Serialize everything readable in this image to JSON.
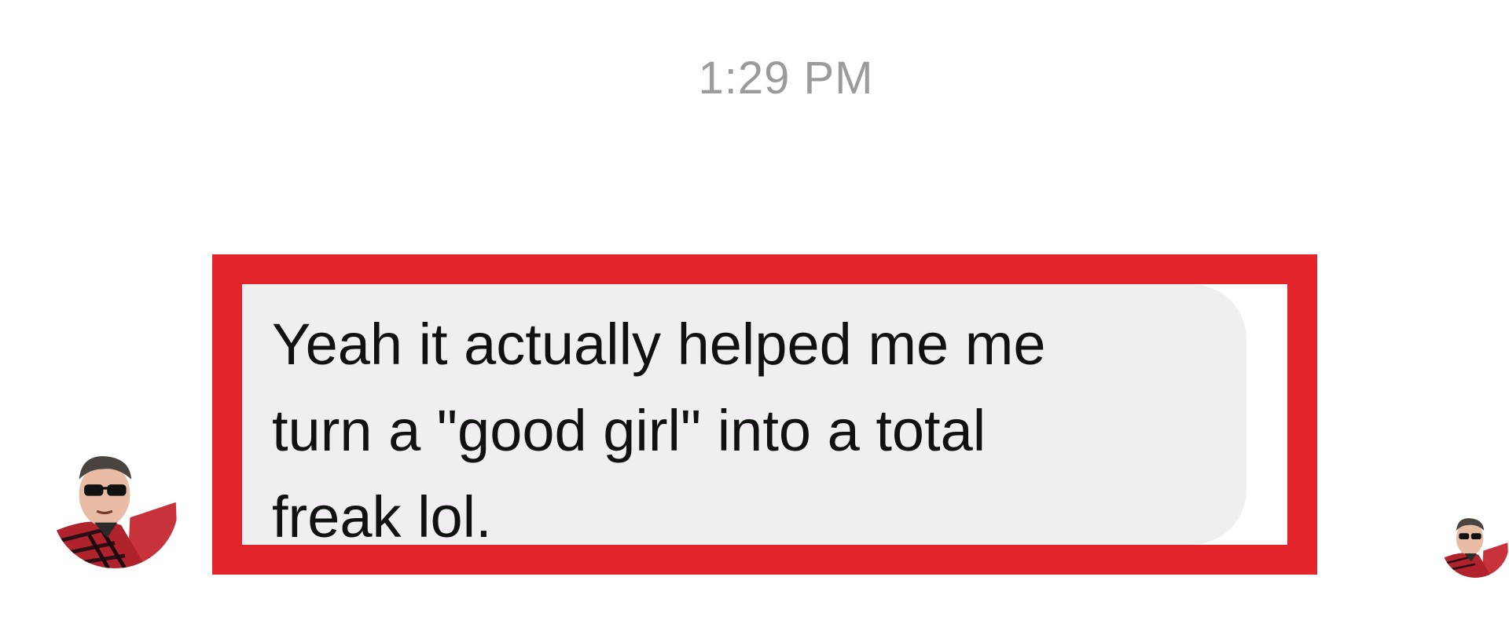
{
  "conversation": {
    "timestamp": "1:29 PM",
    "message": {
      "text": "Yeah it actually helped me me\nturn a \"good girl\" into a total\nfreak lol.",
      "highlight_color": "#e3242b",
      "bubble_color": "#f0eef0"
    },
    "avatars": {
      "sender": "profile-photo",
      "read_receipt": "profile-photo"
    }
  }
}
